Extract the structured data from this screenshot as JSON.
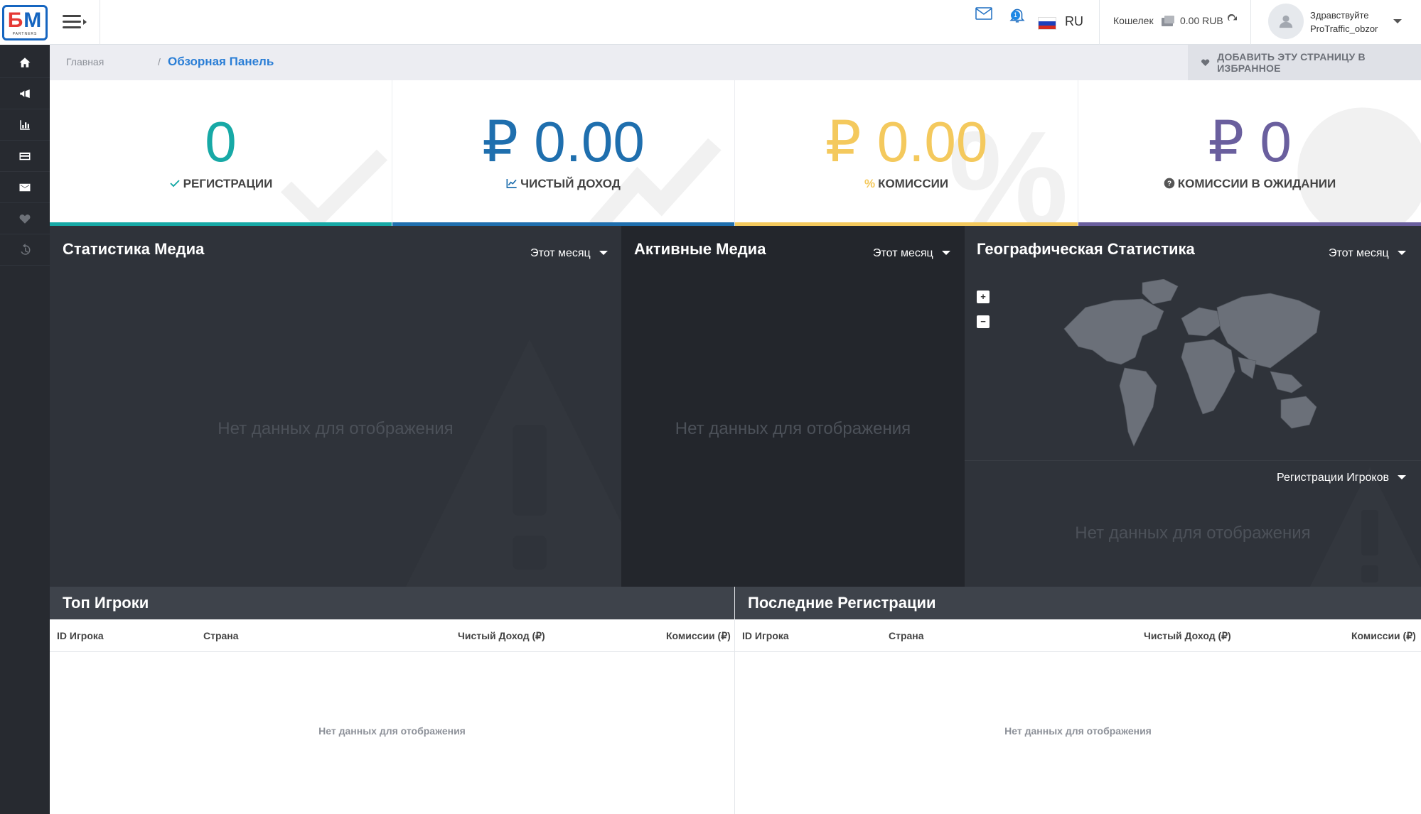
{
  "logo": {
    "b": "Б",
    "m": "М",
    "sub": "PARTNERS"
  },
  "topbar": {
    "lang": "RU",
    "wallet_label": "Кошелек",
    "wallet_amount": "0.00 RUB",
    "greeting": "Здравствуйте",
    "username": "ProTraffic_obzor",
    "notifications_count": "1"
  },
  "breadcrumb": {
    "home": "Главная",
    "sep": "/",
    "current": "Обзорная Панель",
    "favorite_label": "ДОБАВИТЬ ЭТУ СТРАНИЦУ В ИЗБРАННОЕ"
  },
  "kpis": [
    {
      "value": "0",
      "label": "РЕГИСТРАЦИИ",
      "color": "#17a9a6",
      "icon": "check-icon"
    },
    {
      "value": "₽ 0.00",
      "label": "ЧИСТЫЙ ДОХОД",
      "color": "#1f6fae",
      "icon": "line-chart-icon"
    },
    {
      "value": "₽ 0.00",
      "label": "КОМИССИИ",
      "color": "#f4c95d",
      "icon": "percent-icon"
    },
    {
      "value": "₽ 0",
      "label": "КОМИССИИ В ОЖИДАНИИ",
      "color": "#6a5f9e",
      "icon": "question-circle-icon"
    }
  ],
  "panels": {
    "media_stats": {
      "title": "Статистика Медиа",
      "period": "Этот месяц",
      "empty": "Нет данных для отображения"
    },
    "active_media": {
      "title": "Активные Медиа",
      "period": "Этот месяц",
      "empty": "Нет данных для отображения"
    },
    "geo_stats": {
      "title": "Географическая Статистика",
      "period": "Этот месяц",
      "metric": "Регистрации Игроков",
      "empty": "Нет данных для отображения",
      "zoom_in": "+",
      "zoom_out": "−"
    }
  },
  "tables": {
    "top_players": {
      "title": "Топ Игроки",
      "columns": [
        "ID Игрока",
        "Страна",
        "Чистый Доход (₽)",
        "Комиссии (₽)"
      ],
      "empty": "Нет данных для отображения"
    },
    "recent_regs": {
      "title": "Последние Регистрации",
      "columns": [
        "ID Игрока",
        "Страна",
        "Чистый Доход (₽)",
        "Комиссии (₽)"
      ],
      "empty": "Нет данных для отображения"
    }
  },
  "sidebar": {
    "items": [
      {
        "icon": "home-icon"
      },
      {
        "icon": "megaphone-icon"
      },
      {
        "icon": "bar-chart-icon"
      },
      {
        "icon": "credit-card-icon"
      },
      {
        "icon": "envelope-icon"
      },
      {
        "icon": "heart-icon"
      },
      {
        "icon": "history-icon"
      }
    ]
  }
}
